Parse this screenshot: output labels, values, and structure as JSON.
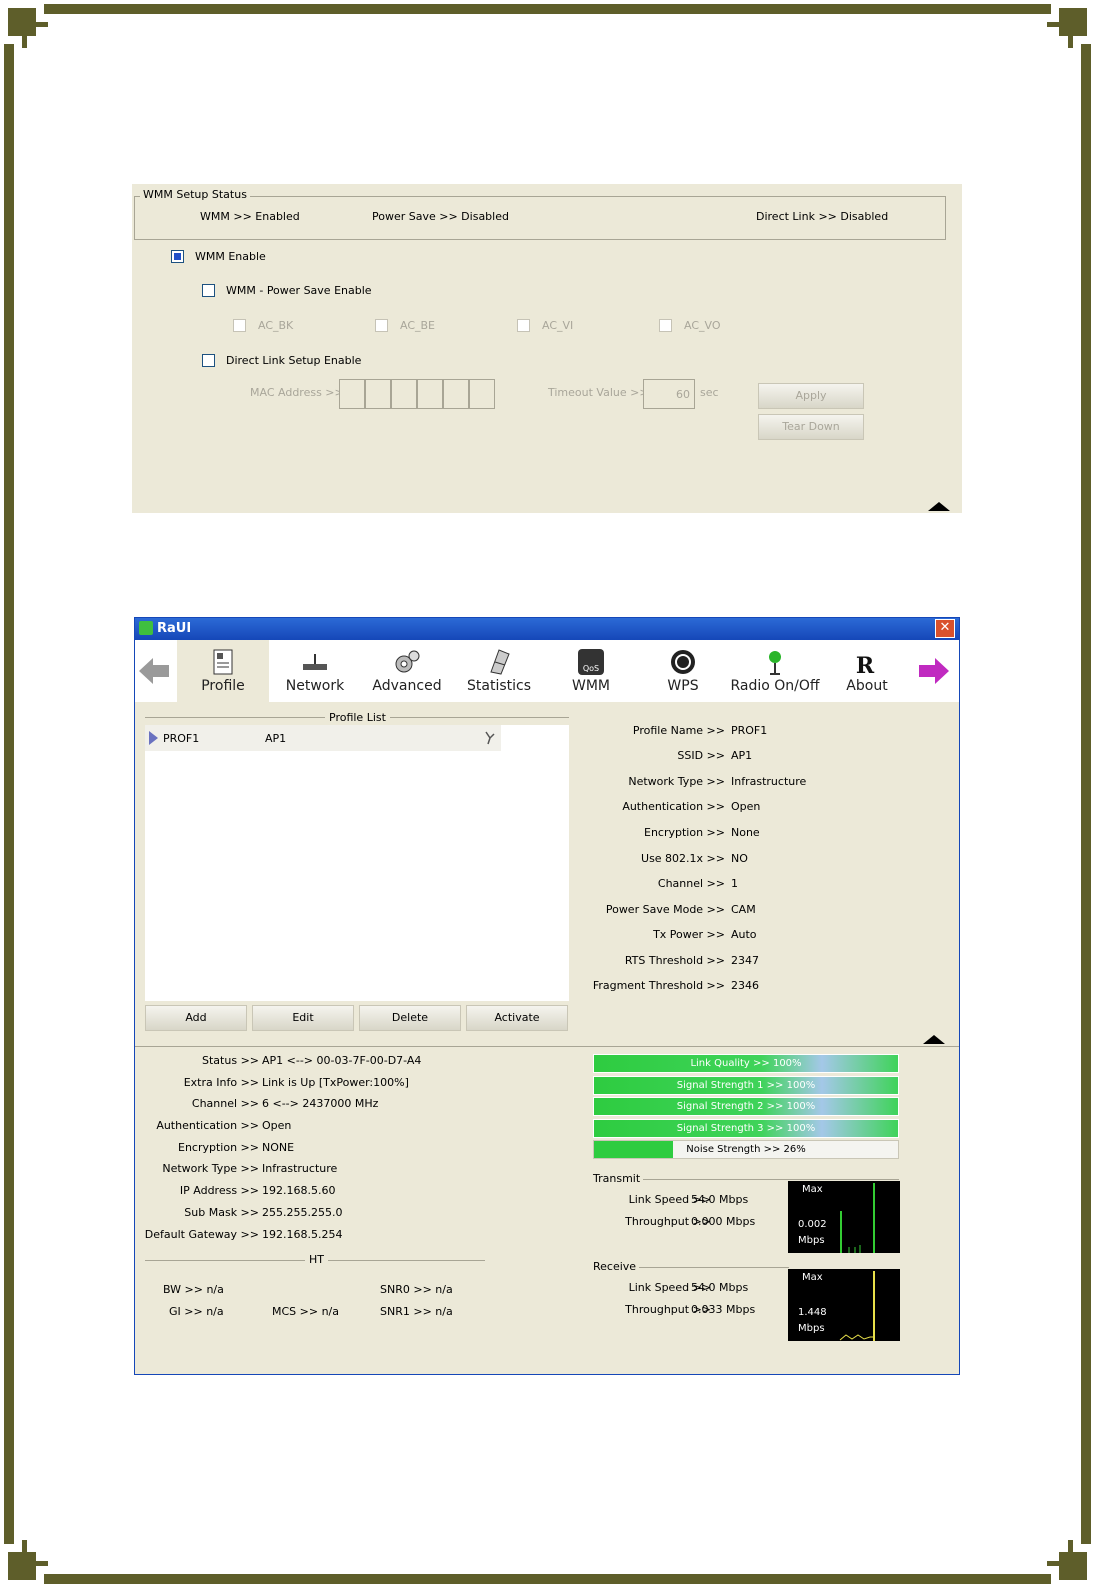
{
  "wmm_panel": {
    "status_legend": "WMM Setup Status",
    "wmm_status": "WMM >> Enabled",
    "power_save_status": "Power Save >> Disabled",
    "direct_link_status": "Direct Link >> Disabled",
    "wmm_enable_label": "WMM Enable",
    "wmm_enable_checked": true,
    "power_save_enable_label": "WMM - Power Save Enable",
    "ac_labels": [
      "AC_BK",
      "AC_BE",
      "AC_VI",
      "AC_VO"
    ],
    "direct_link_label": "Direct Link Setup Enable",
    "mac_address_label": "MAC Address >>",
    "timeout_label": "Timeout Value >>",
    "timeout_value": "60",
    "timeout_unit": "sec",
    "apply_label": "Apply",
    "teardown_label": "Tear Down"
  },
  "raui": {
    "title": "RaUI",
    "toolbar": [
      "Profile",
      "Network",
      "Advanced",
      "Statistics",
      "WMM",
      "WPS",
      "Radio On/Off",
      "About"
    ],
    "active_tab": "Profile",
    "profile_list_legend": "Profile List",
    "profiles": [
      {
        "name": "PROF1",
        "ssid": "AP1"
      }
    ],
    "buttons": {
      "add": "Add",
      "edit": "Edit",
      "delete": "Delete",
      "activate": "Activate"
    },
    "profile_details": [
      {
        "label": "Profile Name >>",
        "value": "PROF1"
      },
      {
        "label": "SSID >>",
        "value": "AP1"
      },
      {
        "label": "Network Type >>",
        "value": "Infrastructure"
      },
      {
        "label": "Authentication >>",
        "value": "Open"
      },
      {
        "label": "Encryption >>",
        "value": "None"
      },
      {
        "label": "Use 802.1x >>",
        "value": "NO"
      },
      {
        "label": "Channel >>",
        "value": "1"
      },
      {
        "label": "Power Save Mode >>",
        "value": "CAM"
      },
      {
        "label": "Tx Power >>",
        "value": "Auto"
      },
      {
        "label": "RTS Threshold >>",
        "value": "2347"
      },
      {
        "label": "Fragment Threshold >>",
        "value": "2346"
      }
    ],
    "status_info": [
      {
        "label": "Status >>",
        "value": "AP1 <--> 00-03-7F-00-D7-A4"
      },
      {
        "label": "Extra Info >>",
        "value": "Link is Up [TxPower:100%]"
      },
      {
        "label": "Channel >>",
        "value": "6 <--> 2437000 MHz"
      },
      {
        "label": "Authentication >>",
        "value": "Open"
      },
      {
        "label": "Encryption >>",
        "value": "NONE"
      },
      {
        "label": "Network Type >>",
        "value": "Infrastructure"
      },
      {
        "label": "IP Address >>",
        "value": "192.168.5.60"
      },
      {
        "label": "Sub Mask >>",
        "value": "255.255.255.0"
      },
      {
        "label": "Default Gateway >>",
        "value": "192.168.5.254"
      }
    ],
    "ht_legend": "HT",
    "ht": {
      "bw": "BW >> n/a",
      "gi": "GI >> n/a",
      "mcs": "MCS >> n/a",
      "snr0": "SNR0 >> n/a",
      "snr1": "SNR1 >> n/a"
    },
    "signal_bars": [
      {
        "label": "Link Quality >> 100%",
        "level": 1.0
      },
      {
        "label": "Signal Strength 1 >> 100%",
        "level": 1.0
      },
      {
        "label": "Signal Strength 2 >> 100%",
        "level": 1.0
      },
      {
        "label": "Signal Strength 3 >> 100%",
        "level": 1.0
      },
      {
        "label": "Noise Strength >> 26%",
        "level": 0.26
      }
    ],
    "transmit": {
      "legend": "Transmit",
      "link_speed_label": "Link Speed >>",
      "link_speed": "54.0 Mbps",
      "throughput_label": "Throughput >>",
      "throughput": "0.000 Mbps",
      "graph_max": "Max",
      "graph_value": "0.002",
      "graph_unit": "Mbps"
    },
    "receive": {
      "legend": "Receive",
      "link_speed_label": "Link Speed >>",
      "link_speed": "54.0 Mbps",
      "throughput_label": "Throughput >>",
      "throughput": "0.033 Mbps",
      "graph_max": "Max",
      "graph_value": "1.448",
      "graph_unit": "Mbps"
    },
    "colors": {
      "title_bar": "#1547b8",
      "signal_green": "#3fd35a",
      "graph_tx": "#33cc33",
      "graph_rx": "#e8e04a"
    }
  }
}
